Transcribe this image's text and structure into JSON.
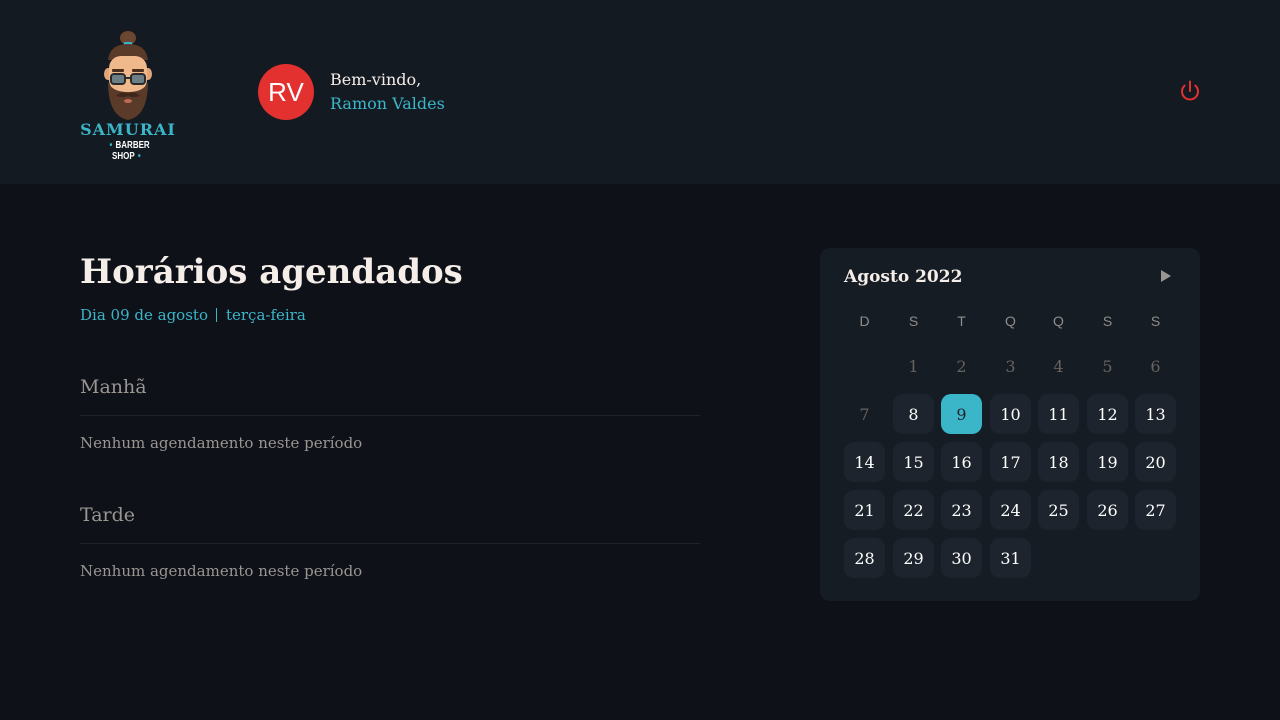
{
  "header": {
    "logo": {
      "title": "SAMURAI",
      "subtitle": "BARBER SHOP"
    },
    "avatar_initials": "RV",
    "welcome": "Bem-vindo,",
    "username": "Ramon Valdes",
    "logout_icon": "power-icon"
  },
  "main": {
    "title": "Horários agendados",
    "date_label": "Dia 09 de agosto",
    "weekday_label": "terça-feira",
    "sections": [
      {
        "title": "Manhã",
        "empty": "Nenhum agendamento neste período"
      },
      {
        "title": "Tarde",
        "empty": "Nenhum agendamento neste período"
      }
    ]
  },
  "calendar": {
    "month_label": "Agosto 2022",
    "next_icon": "triangle-right-icon",
    "weekdays": [
      "D",
      "S",
      "T",
      "Q",
      "Q",
      "S",
      "S"
    ],
    "weeks": [
      [
        null,
        "1",
        "2",
        "3",
        "4",
        "5",
        "6"
      ],
      [
        "7",
        "8",
        "9",
        "10",
        "11",
        "12",
        "13"
      ],
      [
        "14",
        "15",
        "16",
        "17",
        "18",
        "19",
        "20"
      ],
      [
        "21",
        "22",
        "23",
        "24",
        "25",
        "26",
        "27"
      ],
      [
        "28",
        "29",
        "30",
        "31",
        null,
        null,
        null
      ]
    ],
    "selected_day": "9",
    "disabled_days": [
      "1",
      "2",
      "3",
      "4",
      "5",
      "6",
      "7"
    ]
  },
  "colors": {
    "accent": "#3bb6c9",
    "avatar": "#e2312f",
    "logout": "#e2312f",
    "background": "#0f1119",
    "header": "#141a22",
    "calendar": "#161c24"
  }
}
